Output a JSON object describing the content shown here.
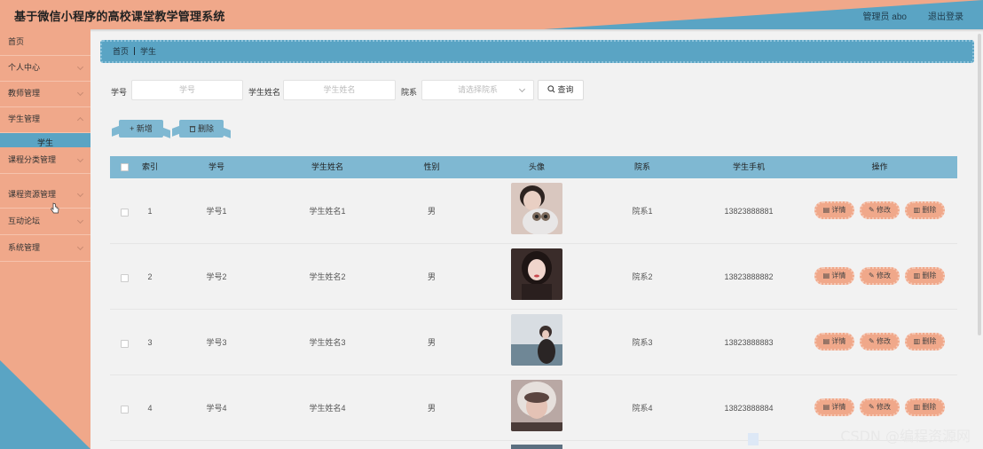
{
  "header": {
    "title": "基于微信小程序的高校课堂教学管理系统",
    "user": "管理员 abo",
    "logout": "退出登录"
  },
  "sidebar": {
    "items": [
      {
        "label": "首页"
      },
      {
        "label": "个人中心"
      },
      {
        "label": "教师管理"
      },
      {
        "label": "学生管理"
      },
      {
        "label": "课程分类管理"
      },
      {
        "label": "课程资源管理"
      },
      {
        "label": "互动论坛"
      },
      {
        "label": "系统管理"
      }
    ],
    "submenu": "学生"
  },
  "breadcrumb": {
    "home": "首页",
    "current": "学生"
  },
  "search": {
    "id_label": "学号",
    "id_placeholder": "学号",
    "name_label": "学生姓名",
    "name_placeholder": "学生姓名",
    "dept_label": "院系",
    "dept_placeholder": "请选择院系",
    "query": "查询"
  },
  "actions": {
    "add": "新增",
    "delete": "删除"
  },
  "table": {
    "columns": [
      "索引",
      "学号",
      "学生姓名",
      "性别",
      "头像",
      "院系",
      "学生手机",
      "操作"
    ],
    "rows": [
      {
        "index": "1",
        "id": "学号1",
        "name": "学生姓名1",
        "gender": "男",
        "dept": "院系1",
        "phone": "13823888881"
      },
      {
        "index": "2",
        "id": "学号2",
        "name": "学生姓名2",
        "gender": "男",
        "dept": "院系2",
        "phone": "13823888882"
      },
      {
        "index": "3",
        "id": "学号3",
        "name": "学生姓名3",
        "gender": "男",
        "dept": "院系3",
        "phone": "13823888883"
      },
      {
        "index": "4",
        "id": "学号4",
        "name": "学生姓名4",
        "gender": "男",
        "dept": "院系4",
        "phone": "13823888884"
      }
    ],
    "row_actions": {
      "detail": "详情",
      "edit": "修改",
      "delete": "删除"
    }
  },
  "watermark": "CSDN @编程资源网",
  "colors": {
    "salmon": "#f0a88a",
    "blue": "#5aa4c4",
    "light_blue": "#7fb8d2"
  }
}
